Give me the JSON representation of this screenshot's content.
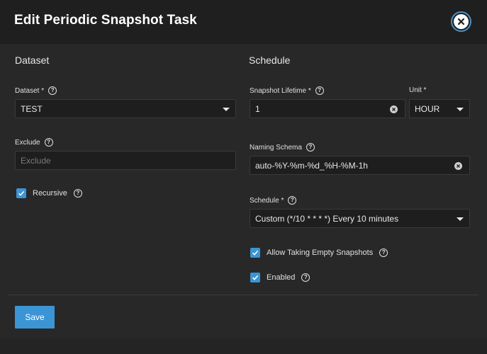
{
  "dialog": {
    "title": "Edit Periodic Snapshot Task",
    "close_icon": "close-icon"
  },
  "dataset_section": {
    "title": "Dataset",
    "dataset": {
      "label": "Dataset *",
      "value": "TEST"
    },
    "exclude": {
      "label": "Exclude",
      "placeholder": "Exclude",
      "value": ""
    },
    "recursive": {
      "label": "Recursive",
      "checked": true
    }
  },
  "schedule_section": {
    "title": "Schedule",
    "lifetime": {
      "label": "Snapshot Lifetime *",
      "value": "1"
    },
    "unit": {
      "label": "Unit *",
      "value": "HOUR"
    },
    "naming_schema": {
      "label": "Naming Schema",
      "value": "auto-%Y-%m-%d_%H-%M-1h"
    },
    "schedule": {
      "label": "Schedule *",
      "value": "Custom (*/10 * * * *) Every 10 minutes"
    },
    "allow_empty": {
      "label": "Allow Taking Empty Snapshots",
      "checked": true
    },
    "enabled": {
      "label": "Enabled",
      "checked": true
    }
  },
  "actions": {
    "save_label": "Save"
  },
  "colors": {
    "accent": "#3b95d4",
    "background": "#282828",
    "header": "#1f1f1f",
    "input": "#1e1e1e"
  }
}
